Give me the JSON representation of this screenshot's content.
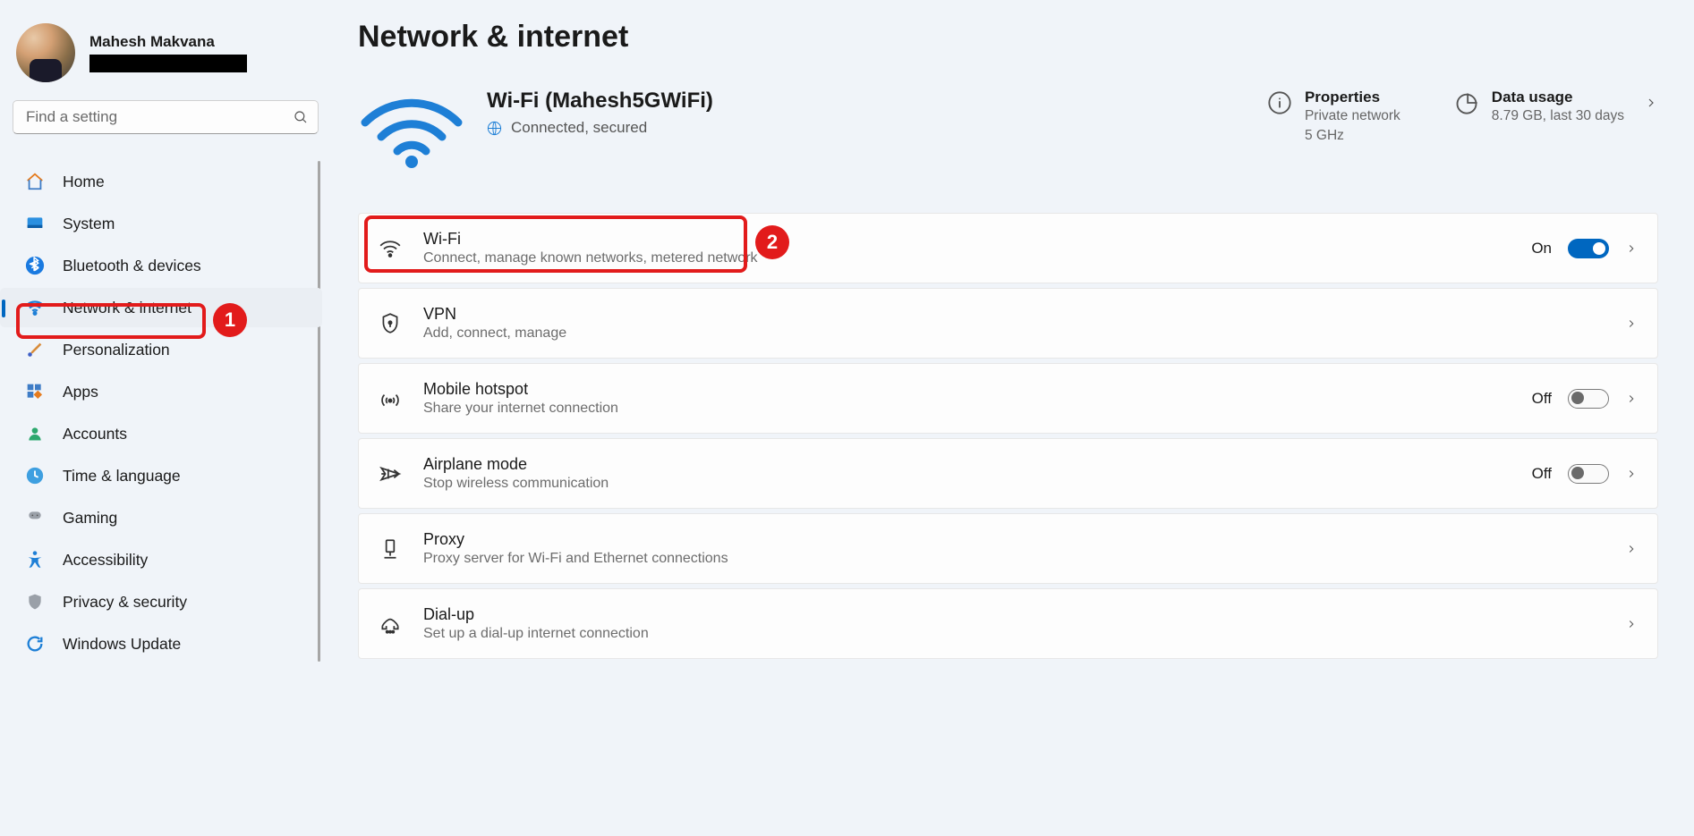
{
  "profile": {
    "name": "Mahesh Makvana"
  },
  "search": {
    "placeholder": "Find a setting"
  },
  "nav": {
    "items": [
      {
        "label": "Home"
      },
      {
        "label": "System"
      },
      {
        "label": "Bluetooth & devices"
      },
      {
        "label": "Network & internet"
      },
      {
        "label": "Personalization"
      },
      {
        "label": "Apps"
      },
      {
        "label": "Accounts"
      },
      {
        "label": "Time & language"
      },
      {
        "label": "Gaming"
      },
      {
        "label": "Accessibility"
      },
      {
        "label": "Privacy & security"
      },
      {
        "label": "Windows Update"
      }
    ]
  },
  "page": {
    "title": "Network & internet"
  },
  "hero": {
    "title": "Wi-Fi (Mahesh5GWiFi)",
    "status": "Connected, secured",
    "properties": {
      "title": "Properties",
      "line1": "Private network",
      "line2": "5 GHz"
    },
    "data_usage": {
      "title": "Data usage",
      "detail": "8.79 GB, last 30 days"
    }
  },
  "cards": {
    "wifi": {
      "title": "Wi-Fi",
      "sub": "Connect, manage known networks, metered network",
      "state": "On"
    },
    "vpn": {
      "title": "VPN",
      "sub": "Add, connect, manage"
    },
    "hotspot": {
      "title": "Mobile hotspot",
      "sub": "Share your internet connection",
      "state": "Off"
    },
    "airplane": {
      "title": "Airplane mode",
      "sub": "Stop wireless communication",
      "state": "Off"
    },
    "proxy": {
      "title": "Proxy",
      "sub": "Proxy server for Wi-Fi and Ethernet connections"
    },
    "dialup": {
      "title": "Dial-up",
      "sub": "Set up a dial-up internet connection"
    }
  },
  "annotations": {
    "badge1": "1",
    "badge2": "2"
  }
}
